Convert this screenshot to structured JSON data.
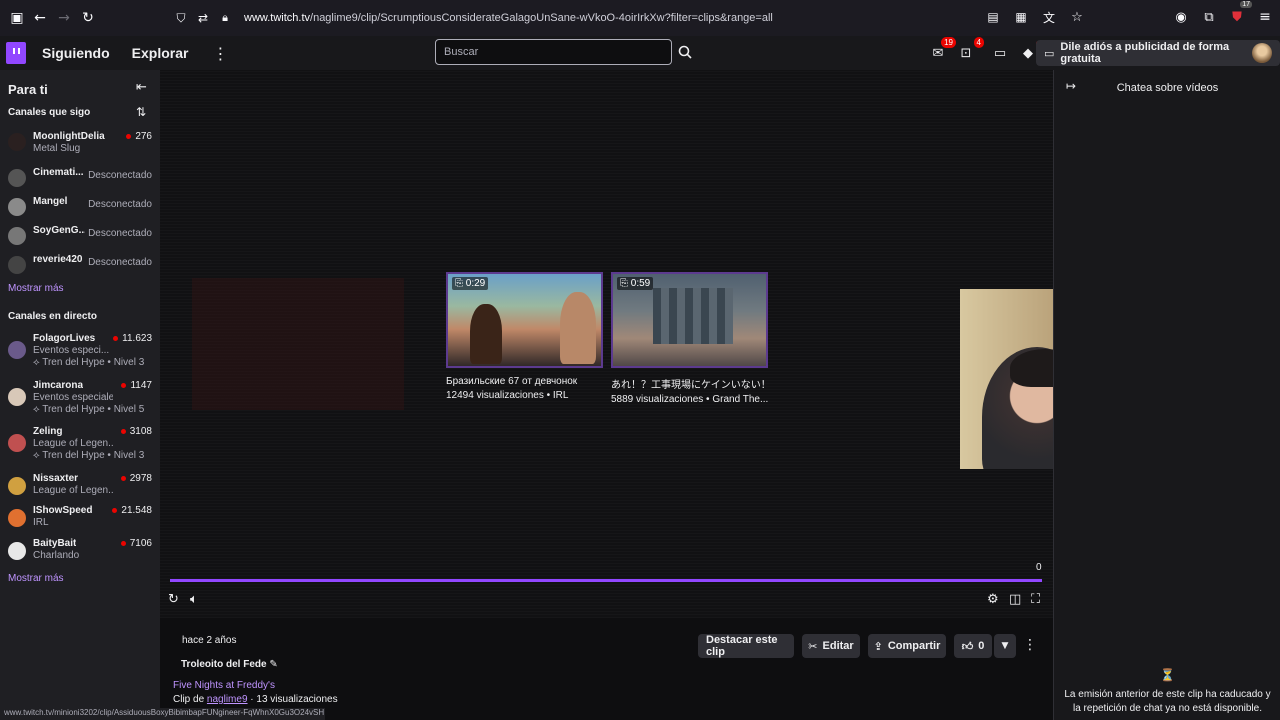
{
  "browser": {
    "url_host": "www.twitch.tv",
    "url_path": "/naglime9/clip/ScrumptiousConsiderateGalagoUnSane-wVkoO-4oirIrkXw?filter=clips&range=all",
    "ext_badge": "17"
  },
  "nav": {
    "following": "Siguiendo",
    "browse": "Explorar",
    "search_placeholder": "Buscar",
    "inbox_badge": "19",
    "notif_badge": "4",
    "adfree": "Dile adiós a publicidad de forma gratuita"
  },
  "sidebar": {
    "title": "Para ti",
    "followed_title": "Canales que sigo",
    "followed": [
      {
        "name": "MoonlightDelia",
        "game": "Metal Slug",
        "viewers": "276",
        "live": true
      },
      {
        "name": "Cinemati...",
        "status": "Desconectado",
        "live": false
      },
      {
        "name": "Mangel",
        "status": "Desconectado",
        "live": false
      },
      {
        "name": "SoyGenG...",
        "status": "Desconectado",
        "live": false
      },
      {
        "name": "reverie420",
        "status": "Desconectado",
        "live": false
      }
    ],
    "show_more": "Mostrar más",
    "live_title": "Canales en directo",
    "live_channels": [
      {
        "name": "FolagorLives",
        "game": "Eventos especi...",
        "viewers": "11.623",
        "hype": "Tren del Hype • Nivel 3"
      },
      {
        "name": "Jimcarona",
        "game": "Eventos especiales",
        "viewers": "1147",
        "hype": "Tren del Hype • Nivel 5"
      },
      {
        "name": "Zeling",
        "game": "League of Legen...",
        "viewers": "3108",
        "hype": "Tren del Hype • Nivel 3"
      },
      {
        "name": "Nissaxter",
        "game": "League of Legen...",
        "viewers": "2978"
      },
      {
        "name": "IShowSpeed",
        "game": "IRL",
        "viewers": "21.548"
      },
      {
        "name": "BaityBait",
        "game": "Charlando",
        "viewers": "7106"
      }
    ],
    "show_more_2": "Mostrar más"
  },
  "player": {
    "clips": [
      {
        "duration": "0:29",
        "title": "Бразильские 67 от девчонок",
        "meta": "12494 visualizaciones • IRL"
      },
      {
        "duration": "0:59",
        "title": "あれ！？工事現場にケインいない！？",
        "meta": "5889 visualizaciones • Grand The..."
      }
    ],
    "time": "0",
    "progress": 1.0
  },
  "clip_info": {
    "age": "hace 2 años",
    "title": "Troleoito del Fede",
    "game": "Five Nights at Freddy's",
    "by_prefix": "Clip de",
    "author": "naglime9",
    "views": "· 13 visualizaciones",
    "feature_btn": "Destacar este clip",
    "edit_btn": "Editar",
    "share_btn": "Compartir",
    "likes": "0"
  },
  "status_url": "www.twitch.tv/minioni3202/clip/AssiduousBoxyBibimbapFUNgineer-FqWhnX0Gu3O24vSH",
  "chat": {
    "title": "Chatea sobre vídeos",
    "message": "La emisión anterior de este clip ha caducado y la repetición de chat ya no está disponible."
  }
}
